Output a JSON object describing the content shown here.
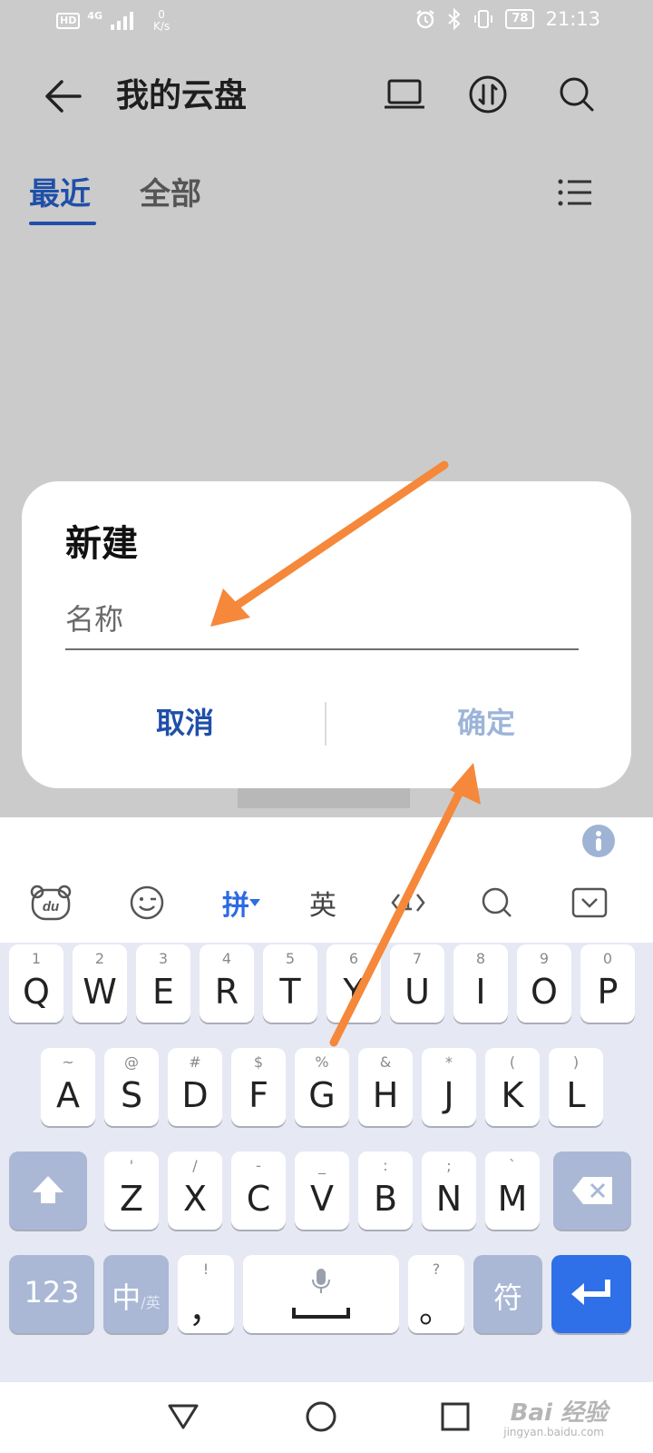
{
  "status_bar": {
    "hd": "HD",
    "network": "4G",
    "speed_value": "0",
    "speed_unit": "K/s",
    "battery": "78",
    "time": "21:13"
  },
  "header": {
    "title": "我的云盘",
    "icons": [
      "back-arrow-icon",
      "laptop-icon",
      "sort-icon",
      "search-icon"
    ]
  },
  "tabs": {
    "recent": "最近",
    "all": "全部",
    "active": "recent"
  },
  "dialog": {
    "title": "新建",
    "name_placeholder": "名称",
    "name_value": "",
    "cancel": "取消",
    "confirm": "确定"
  },
  "keyboard": {
    "toolbar": {
      "logo": "du",
      "pinyin": "拼",
      "english": "英"
    },
    "row1": [
      {
        "sub": "1",
        "main": "Q"
      },
      {
        "sub": "2",
        "main": "W"
      },
      {
        "sub": "3",
        "main": "E"
      },
      {
        "sub": "4",
        "main": "R"
      },
      {
        "sub": "5",
        "main": "T"
      },
      {
        "sub": "6",
        "main": "Y"
      },
      {
        "sub": "7",
        "main": "U"
      },
      {
        "sub": "8",
        "main": "I"
      },
      {
        "sub": "9",
        "main": "O"
      },
      {
        "sub": "0",
        "main": "P"
      }
    ],
    "row2": [
      {
        "sub": "~",
        "main": "A"
      },
      {
        "sub": "@",
        "main": "S"
      },
      {
        "sub": "#",
        "main": "D"
      },
      {
        "sub": "$",
        "main": "F"
      },
      {
        "sub": "%",
        "main": "G"
      },
      {
        "sub": "&",
        "main": "H"
      },
      {
        "sub": "*",
        "main": "J"
      },
      {
        "sub": "(",
        "main": "K"
      },
      {
        "sub": ")",
        "main": "L"
      }
    ],
    "row3": [
      {
        "sub": "'",
        "main": "Z"
      },
      {
        "sub": "/",
        "main": "X"
      },
      {
        "sub": "-",
        "main": "C"
      },
      {
        "sub": "_",
        "main": "V"
      },
      {
        "sub": ":",
        "main": "B"
      },
      {
        "sub": ";",
        "main": "N"
      },
      {
        "sub": "`",
        "main": "M"
      }
    ],
    "row4": {
      "num": "123",
      "lang_main": "中",
      "lang_sub": "/英",
      "comma_sub": "!",
      "comma": "，",
      "period_sub": "?",
      "period": "。",
      "symbol": "符"
    }
  },
  "watermark": {
    "brand": "Bai 经验",
    "url": "jingyan.baidu.com"
  },
  "colors": {
    "accent": "#1f4fa8",
    "arrow": "#f5883a",
    "keyboard_bg": "#e6e9f4",
    "func_key": "#aab8d6",
    "enter_key": "#2f6fe8"
  }
}
